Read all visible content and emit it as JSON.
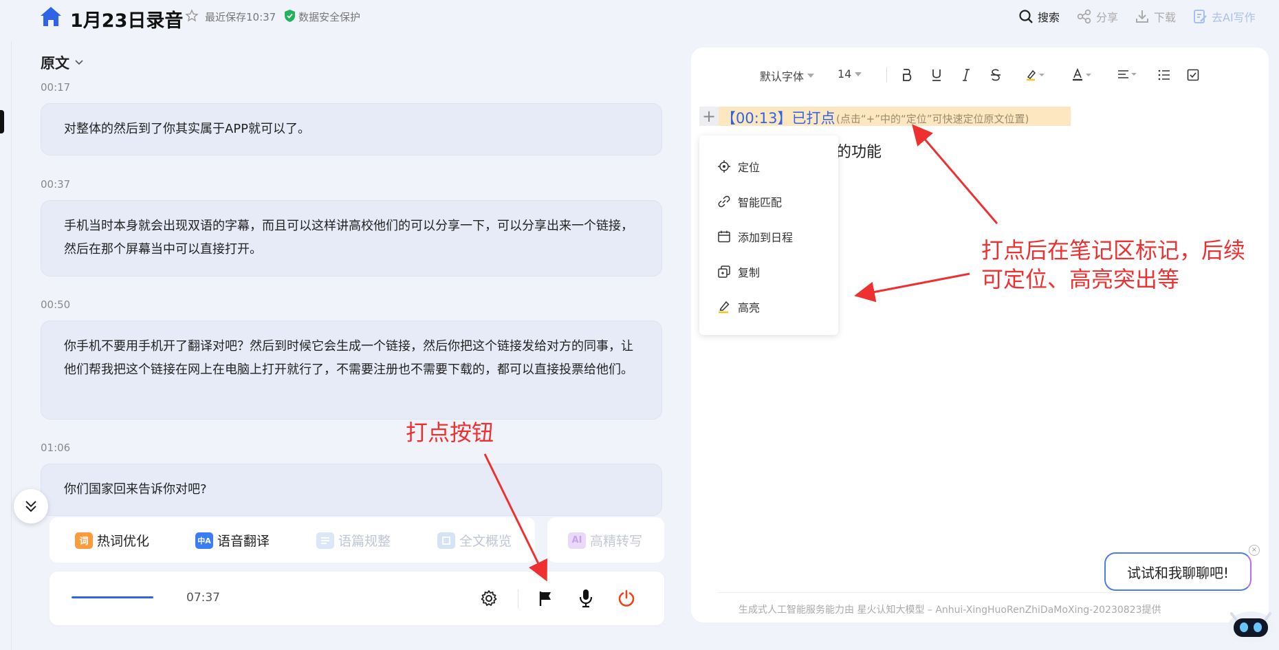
{
  "header": {
    "title": "1月23日录音",
    "saved": "最近保存10:37",
    "security": "数据安全保护",
    "buttons": {
      "search": "搜索",
      "share": "分享",
      "download": "下载",
      "ai_write": "去AI写作"
    }
  },
  "transcript": {
    "section_label": "原文",
    "entries": [
      {
        "time": "00:17",
        "text": "对整体的然后到了你其实属于APP就可以了。"
      },
      {
        "time": "00:37",
        "text": "手机当时本身就会出现双语的字幕，而且可以这样讲高校他们的可以分享一下，可以分享出来一个链接，然后在那个屏幕当中可以直接打开。"
      },
      {
        "time": "00:50",
        "text": "你手机不要用手机开了翻译对吧？然后到时候它会生成一个链接，然后你把这个链接发给对方的同事，让他们帮我把这个链接在网上在电脑上打开就行了，不需要注册也不需要下载的，都可以直接投票给他们。"
      },
      {
        "time": "01:06",
        "text": "你们国家回来告诉你对吧?"
      }
    ]
  },
  "tools": {
    "hotword": {
      "icon": "词",
      "label": "热词优化"
    },
    "translate": {
      "icon": "中A",
      "label": "语音翻译"
    },
    "paragraph": {
      "label": "语篇规整"
    },
    "overview": {
      "label": "全文概览"
    },
    "hd_transcribe": {
      "icon": "AI",
      "label": "高精转写"
    }
  },
  "recorder": {
    "time": "07:37"
  },
  "editor": {
    "font": "默认字体",
    "size": "14",
    "mark_time": "【00:13】已打点",
    "mark_hint": "(点击“+”中的“定位”可快速定位原文位置)",
    "note_text": "的功能"
  },
  "context_menu": {
    "locate": "定位",
    "match": "智能匹配",
    "schedule": "添加到日程",
    "copy": "复制",
    "highlight": "高亮"
  },
  "footer": "生成式人工智能服务能力由 星火认知大模型 – Anhui-XingHuoRenZhiDaMoXing-20230823提供",
  "chat": {
    "prompt": "试试和我聊聊吧!",
    "close": "×"
  },
  "annotations": {
    "mark_button": "打点按钮",
    "mark_note_line1": "打点后在笔记区标记，后续",
    "mark_note_line2": "可定位、高亮突出等"
  },
  "colors": {
    "accent": "#2f64e6",
    "annotation": "#ef3030",
    "highlight": "#fde7c1",
    "power": "#f0421b"
  }
}
